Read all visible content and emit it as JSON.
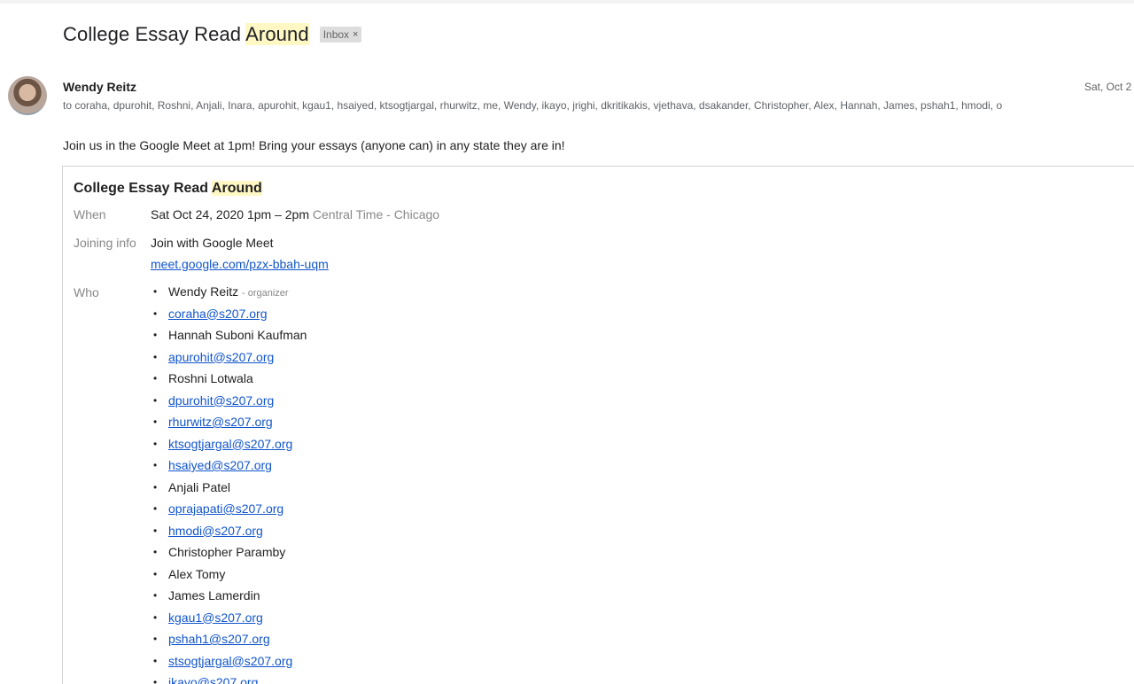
{
  "email": {
    "subject_pre": "College Essay Read ",
    "subject_hl": "Around",
    "label": "Inbox",
    "label_remove": "×",
    "sender": "Wendy Reitz",
    "date": "Sat, Oct 2",
    "recipients": "to coraha, dpurohit, Roshni, Anjali, Inara, apurohit, kgau1, hsaiyed, ktsogtjargal, rhurwitz, me, Wendy, ikayo, jrighi, dkritikakis, vjethava, dsakander, Christopher, Alex, Hannah, James, pshah1, hmodi, o",
    "body": "Join us in the Google Meet at 1pm! Bring your essays (anyone can) in any state they are in!"
  },
  "invite": {
    "title_pre": "College Essay Read ",
    "title_hl": "Around",
    "when_label": "When",
    "when_value": "Sat Oct 24, 2020 1pm – 2pm",
    "when_tz": "Central Time - Chicago",
    "joining_label": "Joining info",
    "joining_value": "Join with Google Meet",
    "joining_link": "meet.google.com/pzx-bbah-uqm",
    "who_label": "Who",
    "organizer_tag": "- organizer",
    "who": [
      {
        "text": "Wendy Reitz",
        "link": false,
        "organizer": true
      },
      {
        "text": "coraha@s207.org",
        "link": true
      },
      {
        "text": "Hannah Suboni Kaufman",
        "link": false
      },
      {
        "text": "apurohit@s207.org",
        "link": true
      },
      {
        "text": "Roshni Lotwala",
        "link": false
      },
      {
        "text": "dpurohit@s207.org",
        "link": true
      },
      {
        "text": "rhurwitz@s207.org",
        "link": true
      },
      {
        "text": "ktsogtjargal@s207.org",
        "link": true
      },
      {
        "text": "hsaiyed@s207.org",
        "link": true
      },
      {
        "text": "Anjali Patel",
        "link": false
      },
      {
        "text": "oprajapati@s207.org",
        "link": true
      },
      {
        "text": "hmodi@s207.org",
        "link": true
      },
      {
        "text": "Christopher Paramby",
        "link": false
      },
      {
        "text": "Alex Tomy",
        "link": false
      },
      {
        "text": "James Lamerdin",
        "link": false
      },
      {
        "text": "kgau1@s207.org",
        "link": true
      },
      {
        "text": "pshah1@s207.org",
        "link": true
      },
      {
        "text": "stsogtjargal@s207.org",
        "link": true
      },
      {
        "text": "ikayo@s207.org",
        "link": true
      }
    ]
  },
  "colors": {
    "highlight": "#fff8c5",
    "link": "#1155cc",
    "label_muted": "#888888"
  }
}
